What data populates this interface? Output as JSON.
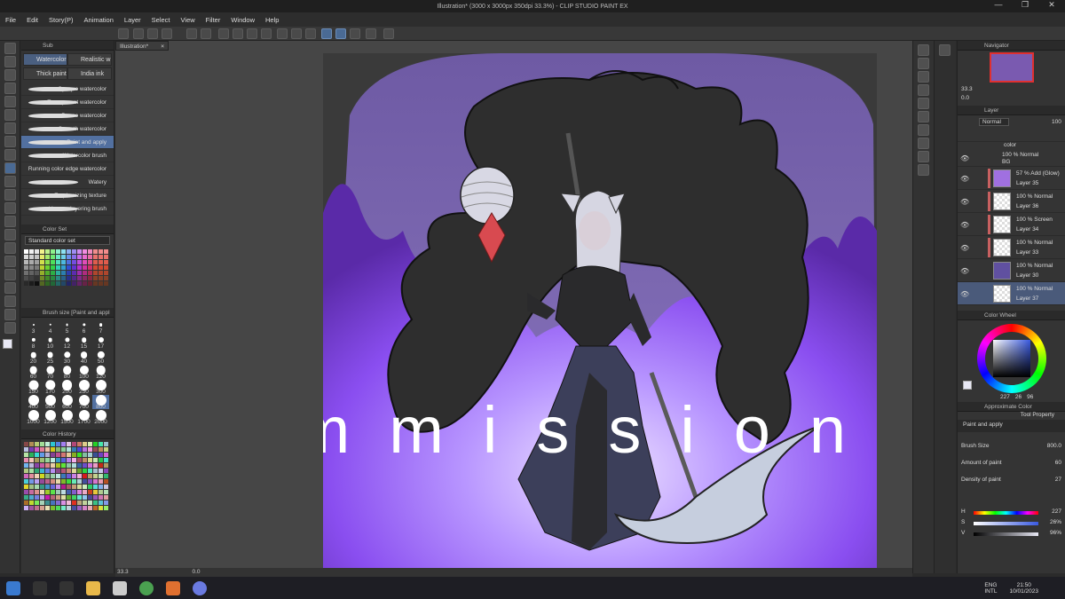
{
  "window": {
    "title": "Illustration* (3000 x 3000px 350dpi 33.3%) - CLIP STUDIO PAINT EX",
    "minimize": "—",
    "maximize": "❐",
    "close": "✕"
  },
  "menu": [
    "File",
    "Edit",
    "Story(P)",
    "Animation",
    "Layer",
    "Select",
    "View",
    "Filter",
    "Window",
    "Help"
  ],
  "sub_tool": {
    "header": "Sub",
    "tabs": [
      "Watercolor",
      "Realistic w",
      "Thick paint",
      "India ink"
    ],
    "brushes": [
      "Opaque watercolor",
      "Transparent watercolor",
      "Dense watercolor",
      "Smooth watercolor",
      "Paint and apply",
      "Watercolor brush",
      "Running color edge watercolor",
      "Watery",
      "Emphasizing texture",
      "Uneven layering brush"
    ],
    "selected_brush": "Paint and apply"
  },
  "color_set": {
    "header": "Color Set",
    "dropdown": "Standard color set"
  },
  "brush_size": {
    "header": "Brush size [Paint and appl",
    "sizes": [
      "3",
      "4",
      "5",
      "6",
      "7",
      "8",
      "10",
      "12",
      "15",
      "17",
      "20",
      "25",
      "30",
      "40",
      "50",
      "60",
      "70",
      "80",
      "100",
      "120",
      "150",
      "170",
      "200",
      "250",
      "300",
      "400",
      "500",
      "600",
      "700",
      "800",
      "1000",
      "1200",
      "1500",
      "1700",
      "2000"
    ],
    "selected": "800"
  },
  "color_history": {
    "header": "Color History"
  },
  "document": {
    "tab": "Illustration*",
    "close": "×"
  },
  "watermark": "Commission",
  "status": {
    "zoom": "33.3",
    "rotation": "0.0"
  },
  "navigator": {
    "header": "Navigator",
    "zoom": "33.3",
    "angle": "0.0"
  },
  "layer": {
    "header": "Layer",
    "blend": "Normal",
    "opacity": "100",
    "rows": [
      {
        "mode": "color",
        "name": ""
      },
      {
        "mode": "100 % Normal",
        "name": "BG"
      },
      {
        "mode": "57 % Add (Glow)",
        "name": "Layer 35"
      },
      {
        "mode": "100 % Normal",
        "name": "Layer 36"
      },
      {
        "mode": "100 % Screen",
        "name": "Layer 34"
      },
      {
        "mode": "100 % Normal",
        "name": "Layer 33"
      },
      {
        "mode": "100 % Normal",
        "name": "Layer 30"
      },
      {
        "mode": "100 % Normal",
        "name": "Layer 37"
      }
    ]
  },
  "color_wheel": {
    "header": "Color Wheel",
    "h": "227",
    "s": "26",
    "v": "96",
    "main_color": "#e8e8f4"
  },
  "tool_property": {
    "header": "Tool Property",
    "approx_header": "Approximate Color",
    "tool_name": "Paint and apply",
    "brush_size_label": "Brush Size",
    "brush_size_value": "800.0",
    "amount_label": "Amount of paint",
    "amount_value": "60",
    "density_label": "Density of paint",
    "density_value": "27"
  },
  "hsv": {
    "h_label": "H",
    "h_value": "227",
    "s_label": "S",
    "s_value": "26%",
    "v_label": "V",
    "v_value": "96%"
  },
  "taskbar": {
    "lang1": "ENG",
    "lang2": "INTL",
    "time": "21:50",
    "date": "10/01/2023"
  }
}
